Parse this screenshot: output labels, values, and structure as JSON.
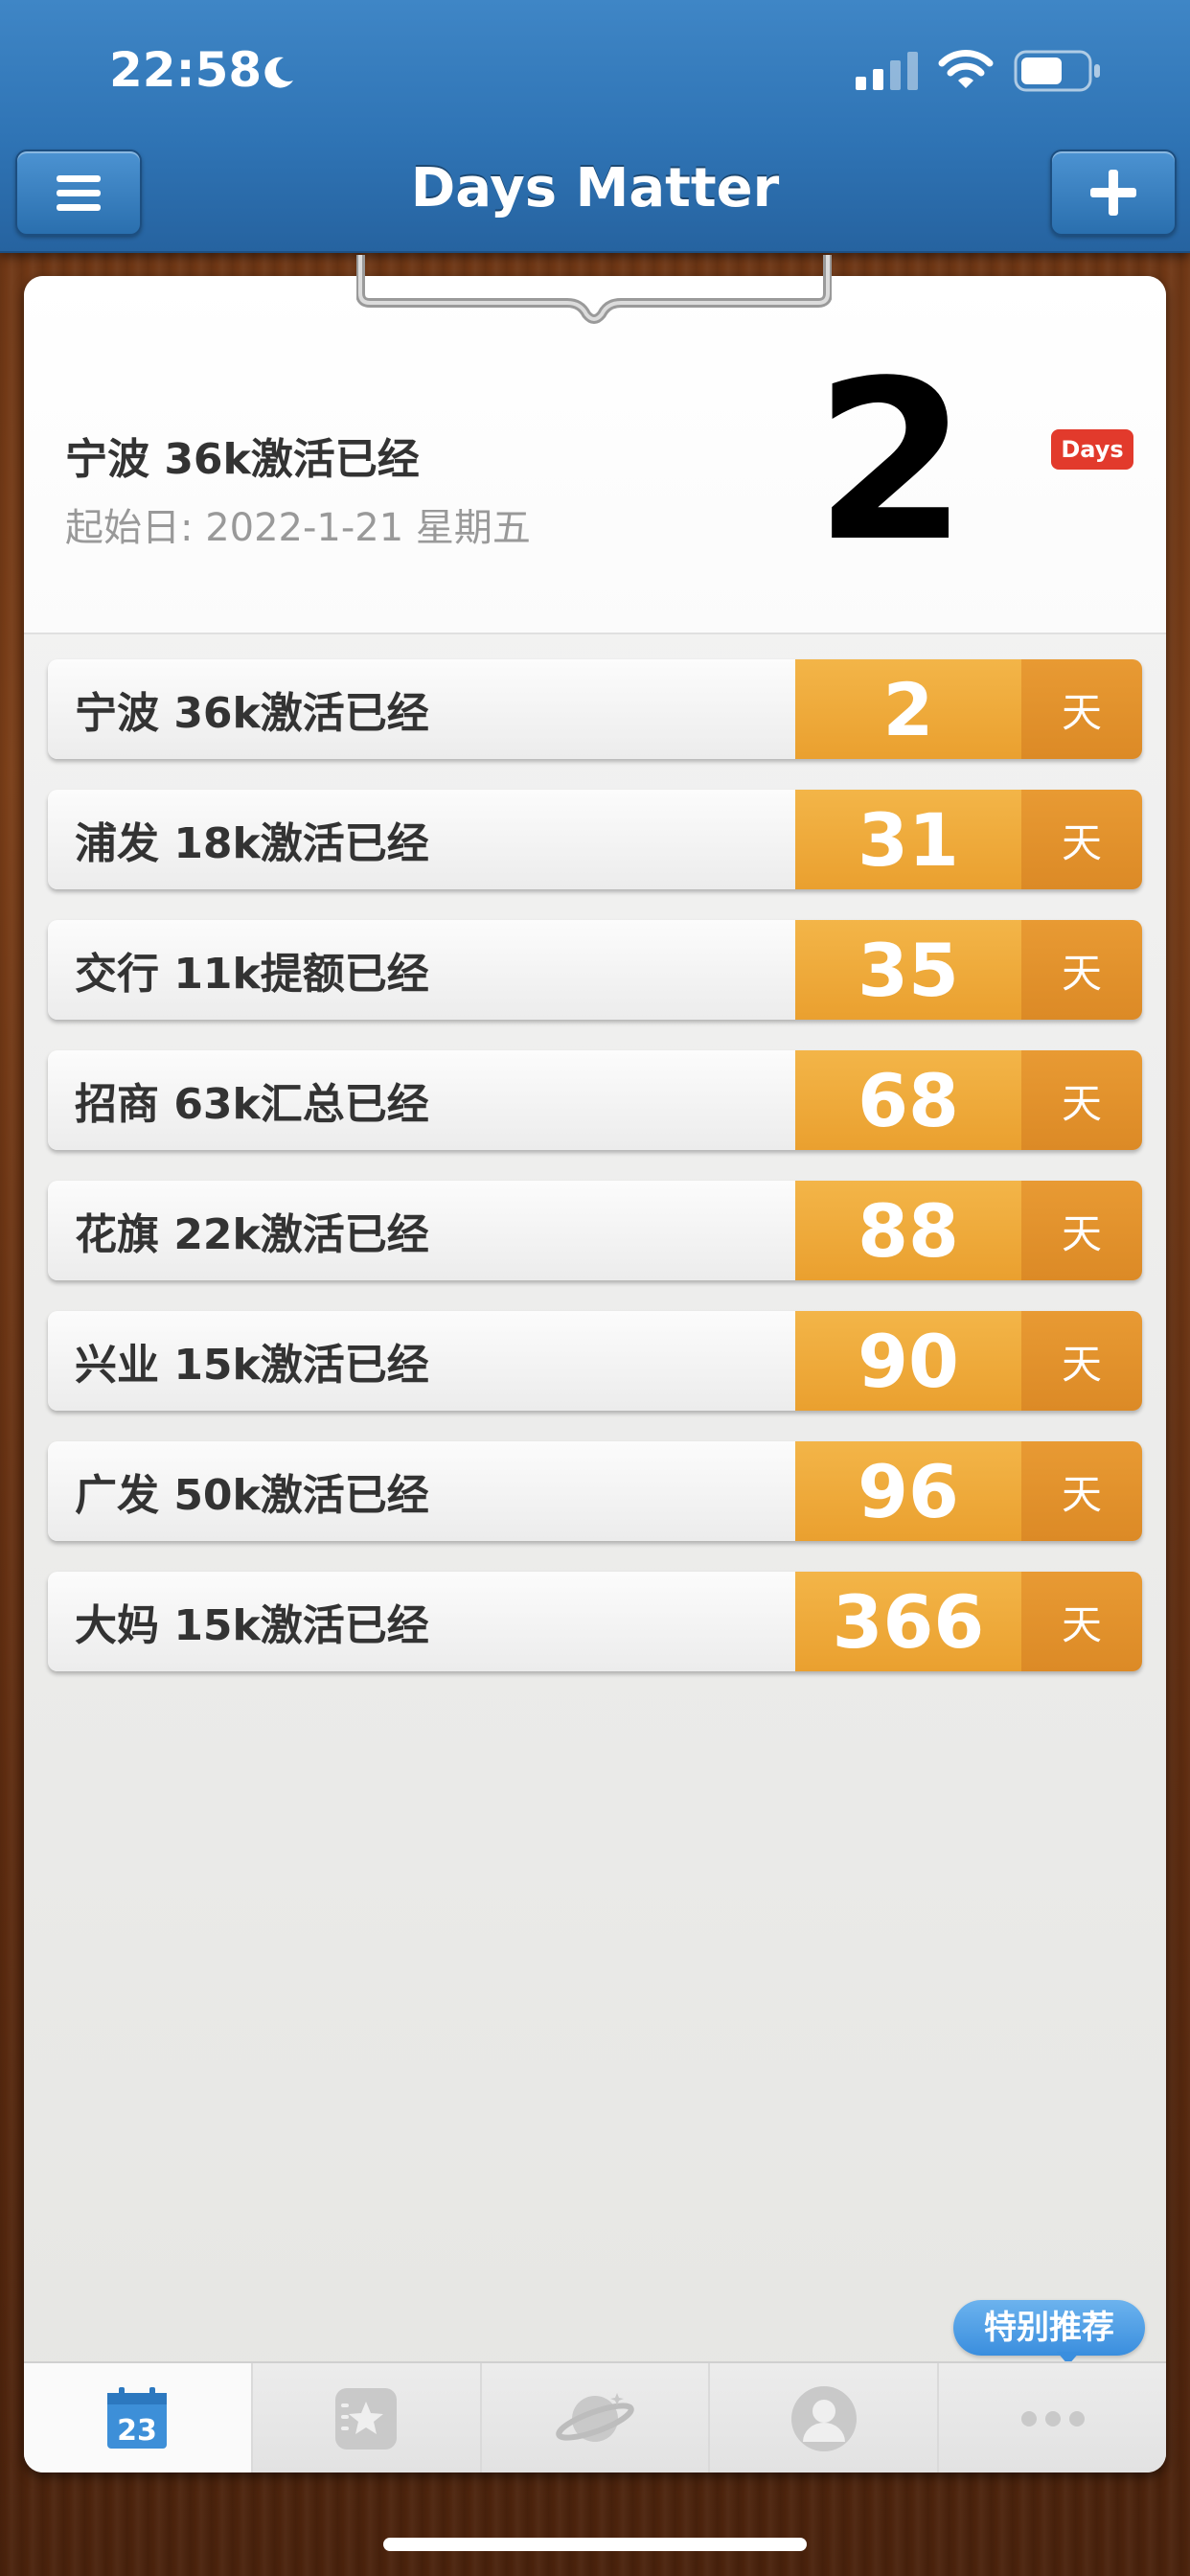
{
  "status_bar": {
    "time": "22:58"
  },
  "nav": {
    "title": "Days Matter"
  },
  "header": {
    "title": "宁波 36k激活已经",
    "start_label": "起始日: 2022-1-21 星期五",
    "count": "2",
    "badge": "Days"
  },
  "events": [
    {
      "label": "宁波 36k激活已经",
      "days": "2",
      "unit": "天"
    },
    {
      "label": "浦发 18k激活已经",
      "days": "31",
      "unit": "天"
    },
    {
      "label": "交行 11k提额已经",
      "days": "35",
      "unit": "天"
    },
    {
      "label": "招商 63k汇总已经",
      "days": "68",
      "unit": "天"
    },
    {
      "label": "花旗 22k激活已经",
      "days": "88",
      "unit": "天"
    },
    {
      "label": "兴业 15k激活已经",
      "days": "90",
      "unit": "天"
    },
    {
      "label": "广发 50k激活已经",
      "days": "96",
      "unit": "天"
    },
    {
      "label": "大妈 15k激活已经",
      "days": "366",
      "unit": "天"
    }
  ],
  "tabbar": {
    "calendar_day": "23",
    "promo": "特别推荐",
    "tabs": [
      "calendar-icon",
      "bookmark-star-icon",
      "planet-icon",
      "person-icon",
      "more-icon"
    ]
  },
  "colors": {
    "nav_blue": "#2f74b5",
    "accent_orange": "#eaa02f",
    "unit_orange": "#dc8a26",
    "badge_red": "#e23a2c",
    "wood": "#6a3414"
  }
}
